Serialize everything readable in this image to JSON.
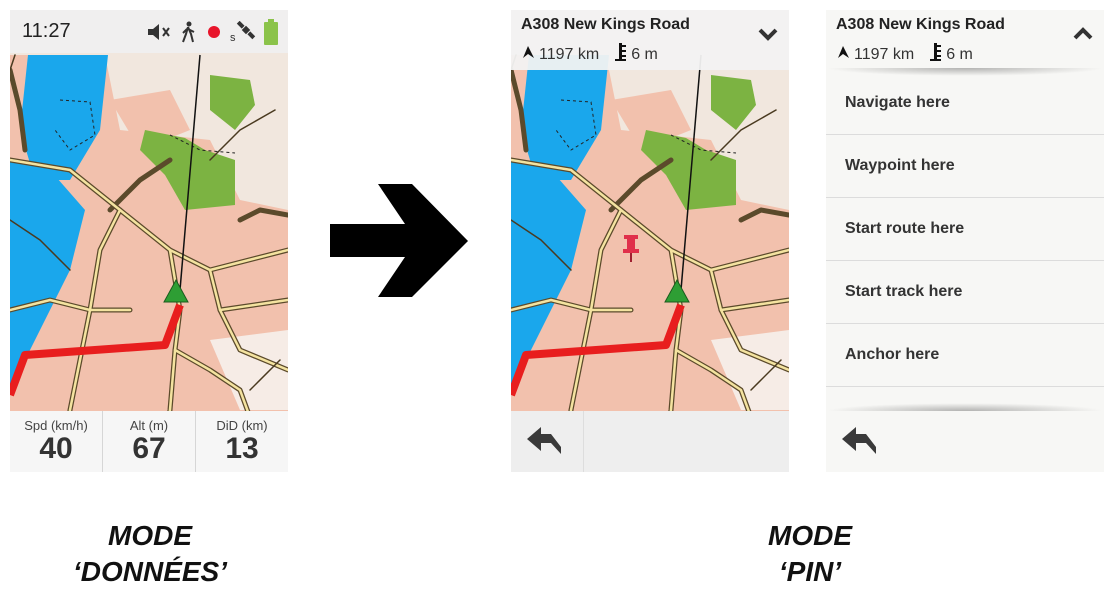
{
  "screen_data": {
    "status": {
      "time": "11:27"
    },
    "fields": [
      {
        "label": "Spd (km/h)",
        "value": "40"
      },
      {
        "label": "Alt (m)",
        "value": "67"
      },
      {
        "label": "DiD (km)",
        "value": "13"
      }
    ]
  },
  "screen_pin": {
    "road": "A308  New Kings Road",
    "distance": "1197 km",
    "elevation": "6 m"
  },
  "screen_menu": {
    "road": "A308  New Kings Road",
    "distance": "1197 km",
    "elevation": "6 m",
    "items": [
      "Navigate here",
      "Waypoint here",
      "Start route here",
      "Start track here",
      "Anchor here"
    ]
  },
  "captions": {
    "left": [
      "MODE",
      "‘DONNÉES’"
    ],
    "right": [
      "MODE",
      "‘PIN’"
    ]
  },
  "colors": {
    "water": "#1aa7ec",
    "urban": "#f2c1ad",
    "park": "#7cb342",
    "route": "#e81e1e",
    "road_casing": "#5b4a2b",
    "road_fill": "#f4e3a0"
  },
  "icons": [
    "mute-icon",
    "hiker-icon",
    "record-icon",
    "satellite-icon",
    "battery-icon",
    "navigation-arrow-icon",
    "elevation-icon",
    "chevron-down-icon",
    "chevron-up-icon",
    "back-arrow-icon",
    "pin-icon",
    "right-arrow-icon"
  ]
}
